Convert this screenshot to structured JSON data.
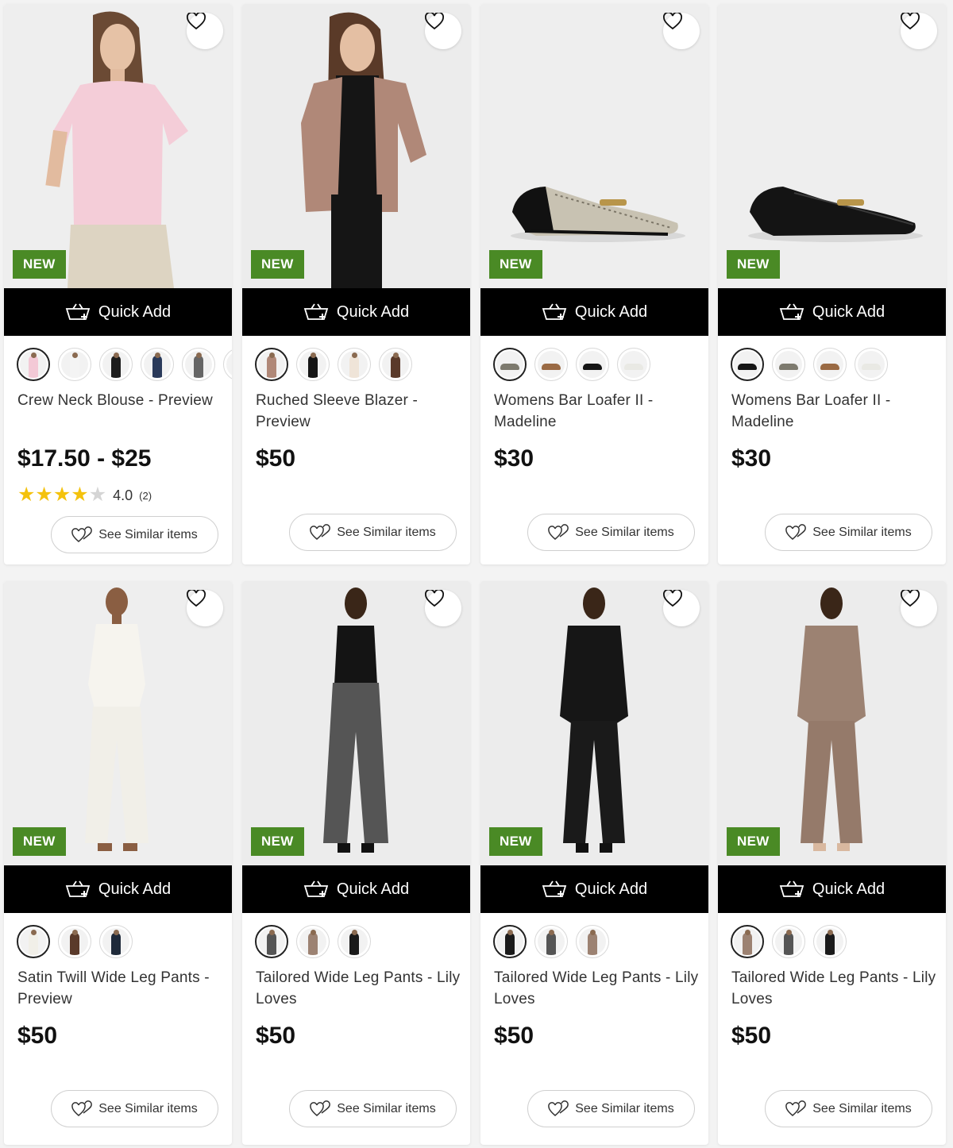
{
  "badge_label": "NEW",
  "quick_add_label": "Quick Add",
  "see_similar_label": "See Similar items",
  "icons": {
    "wishlist": "heart-icon",
    "quick_add": "basket-plus-icon",
    "similar": "hearts-icon",
    "star": "star-icon"
  },
  "colors": {
    "badge": "#4a8a25",
    "quick_add_bg": "#000000",
    "star": "#f4c20d",
    "star_empty": "#d5d5d5"
  },
  "products": [
    {
      "title": "Crew Neck Blouse - Preview",
      "price": "$17.50 - $25",
      "rating": {
        "average": "4.0",
        "count": "(2)",
        "stars_filled": 4
      },
      "swatches": [
        {
          "color": "#f3c9d6",
          "selected": true
        },
        {
          "color": "#f4f4f4"
        },
        {
          "color": "#1d1d1d"
        },
        {
          "color": "#2a3a5a"
        },
        {
          "color": "#666666"
        },
        {
          "color": "#111111"
        }
      ]
    },
    {
      "title": "Ruched Sleeve Blazer - Preview",
      "price": "$50",
      "swatches": [
        {
          "color": "#b08878",
          "selected": true
        },
        {
          "color": "#151515"
        },
        {
          "color": "#efe4d8"
        },
        {
          "color": "#5a3a2a"
        }
      ]
    },
    {
      "title": "Womens Bar Loafer II - Madeline",
      "price": "$30",
      "swatches": [
        {
          "color": "#7d7a6e",
          "selected": true,
          "kind": "shoe"
        },
        {
          "color": "#9a6a44",
          "kind": "shoe"
        },
        {
          "color": "#151515",
          "kind": "shoe"
        },
        {
          "color": "#e9e9e4",
          "kind": "shoe"
        }
      ]
    },
    {
      "title": "Womens Bar Loafer II - Madeline",
      "price": "$30",
      "swatches": [
        {
          "color": "#151515",
          "selected": true,
          "kind": "shoe"
        },
        {
          "color": "#7d7a6e",
          "kind": "shoe"
        },
        {
          "color": "#9a6a44",
          "kind": "shoe"
        },
        {
          "color": "#e9e9e4",
          "kind": "shoe"
        }
      ]
    },
    {
      "title": "Satin Twill Wide Leg Pants - Preview",
      "price": "$50",
      "swatches": [
        {
          "color": "#f1efe8",
          "selected": true
        },
        {
          "color": "#5a3a2a"
        },
        {
          "color": "#1f2a3a"
        }
      ]
    },
    {
      "title": "Tailored Wide Leg Pants - Lily Loves",
      "price": "$50",
      "swatches": [
        {
          "color": "#555555",
          "selected": true
        },
        {
          "color": "#9c8272"
        },
        {
          "color": "#1a1a1a"
        }
      ]
    },
    {
      "title": "Tailored Wide Leg Pants - Lily Loves",
      "price": "$50",
      "swatches": [
        {
          "color": "#1a1a1a",
          "selected": true
        },
        {
          "color": "#555555"
        },
        {
          "color": "#9c8272"
        }
      ]
    },
    {
      "title": "Tailored Wide Leg Pants - Lily Loves",
      "price": "$50",
      "swatches": [
        {
          "color": "#9c8272",
          "selected": true
        },
        {
          "color": "#555555"
        },
        {
          "color": "#1a1a1a"
        }
      ]
    }
  ]
}
